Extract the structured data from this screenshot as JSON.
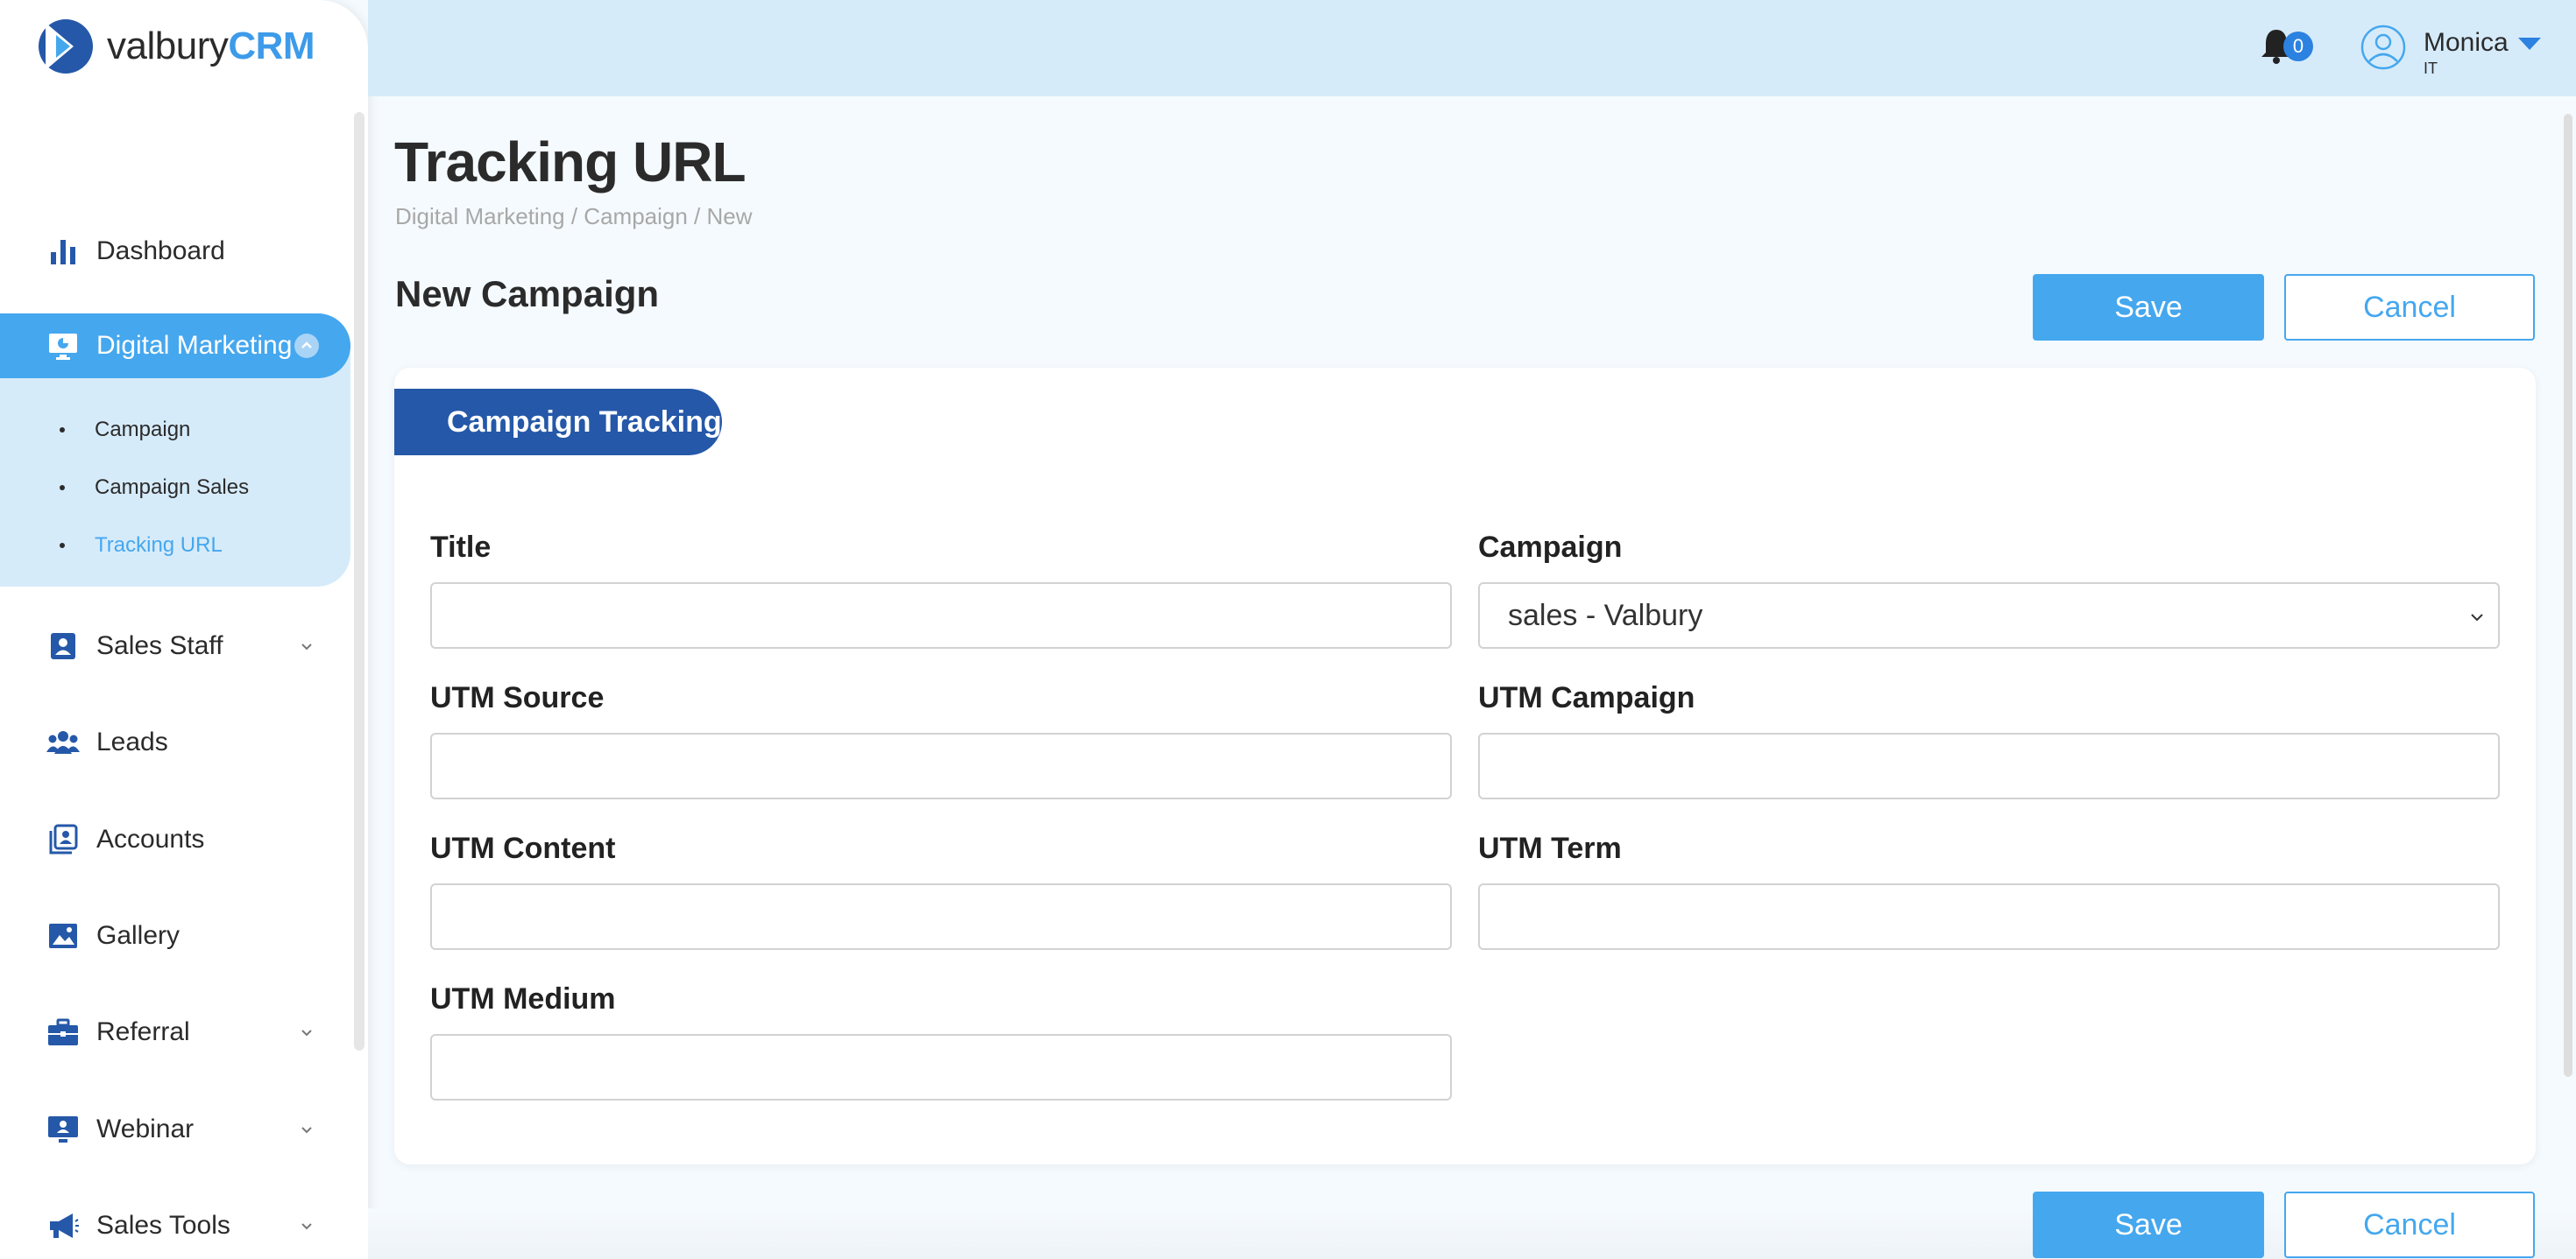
{
  "brand": {
    "name_prefix": "valbury",
    "name_suffix": "CRM"
  },
  "colors": {
    "accent": "#45a7ee",
    "dark_blue": "#2558a8",
    "sidebar_active_bg": "#d6ebfa",
    "header_bg": "#d6ebfa"
  },
  "header": {
    "notification_count": "0",
    "user_name": "Monica",
    "user_role": "IT"
  },
  "sidebar": {
    "items": [
      {
        "label": "Dashboard",
        "icon": "bar-chart-icon"
      },
      {
        "label": "Digital Marketing",
        "icon": "monitor-chart-icon",
        "expanded": true,
        "children": [
          {
            "label": "Campaign"
          },
          {
            "label": "Campaign Sales"
          },
          {
            "label": "Tracking URL",
            "active": true
          }
        ]
      },
      {
        "label": "Sales Staff",
        "icon": "contact-card-icon",
        "has_submenu": true
      },
      {
        "label": "Leads",
        "icon": "users-group-icon"
      },
      {
        "label": "Accounts",
        "icon": "accounts-icon"
      },
      {
        "label": "Gallery",
        "icon": "image-icon"
      },
      {
        "label": "Referral",
        "icon": "briefcase-icon",
        "has_submenu": true
      },
      {
        "label": "Webinar",
        "icon": "presentation-icon",
        "has_submenu": true
      },
      {
        "label": "Sales Tools",
        "icon": "megaphone-icon",
        "has_submenu": true
      }
    ]
  },
  "page": {
    "title": "Tracking URL",
    "breadcrumb": "Digital Marketing / Campaign / New",
    "section_title": "New Campaign",
    "save_label": "Save",
    "cancel_label": "Cancel",
    "tab_label": "Campaign Tracking"
  },
  "form": {
    "title": {
      "label": "Title",
      "value": ""
    },
    "campaign": {
      "label": "Campaign",
      "value": "sales - Valbury"
    },
    "utm_source": {
      "label": "UTM Source",
      "value": ""
    },
    "utm_campaign": {
      "label": "UTM Campaign",
      "value": ""
    },
    "utm_content": {
      "label": "UTM Content",
      "value": ""
    },
    "utm_term": {
      "label": "UTM Term",
      "value": ""
    },
    "utm_medium": {
      "label": "UTM Medium",
      "value": ""
    }
  }
}
